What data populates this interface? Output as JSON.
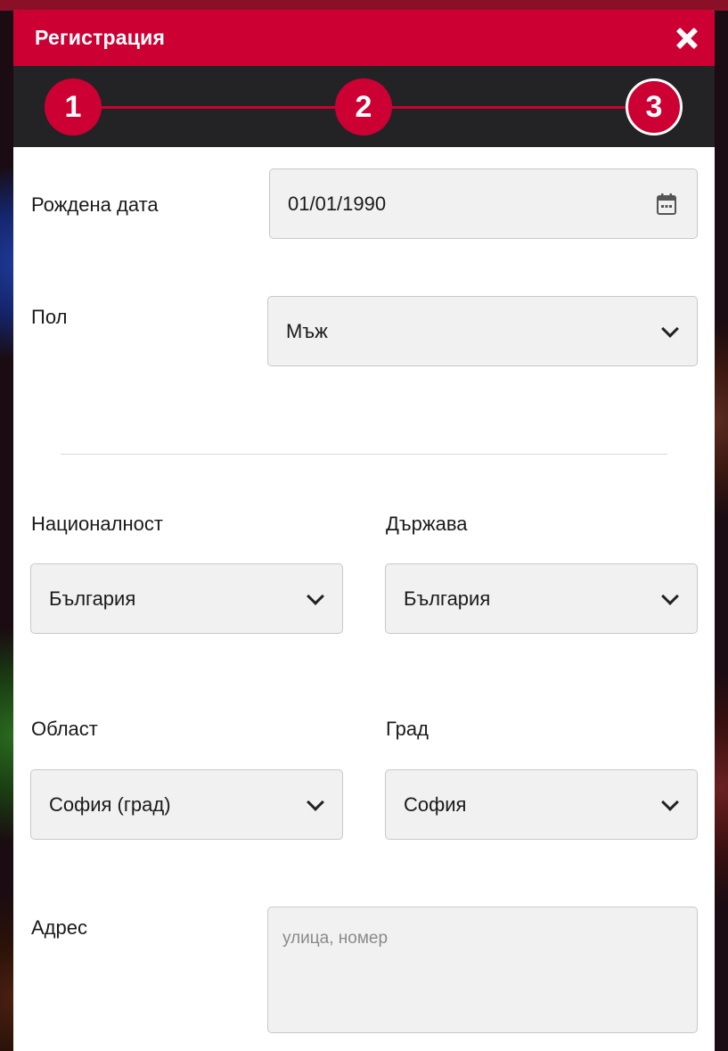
{
  "modal": {
    "title": "Регистрация",
    "close_icon": "close-icon"
  },
  "stepper": {
    "steps": [
      "1",
      "2",
      "3"
    ],
    "current_step": 3
  },
  "form": {
    "birthdate": {
      "label": "Рождена дата",
      "value": "01/01/1990",
      "icon": "calendar-icon"
    },
    "gender": {
      "label": "Пол",
      "value": "Мъж"
    },
    "nationality": {
      "label": "Националност",
      "value": "България"
    },
    "country": {
      "label": "Държава",
      "value": "България"
    },
    "region": {
      "label": "Област",
      "value": "София (град)"
    },
    "city": {
      "label": "Град",
      "value": "София"
    },
    "address": {
      "label": "Адрес",
      "placeholder": "улица, номер"
    }
  },
  "colors": {
    "accent": "#cc0033",
    "stepper_bg": "#232326",
    "field_bg": "#f1f1f1"
  }
}
